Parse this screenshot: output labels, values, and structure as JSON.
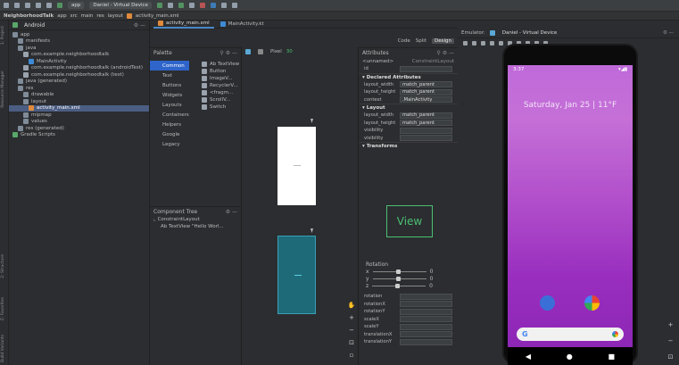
{
  "toolbar": {
    "run_config": "app",
    "device": "Daniel - Virtual Device"
  },
  "breadcrumb": [
    "NeighborhoodTalk",
    "app",
    "src",
    "main",
    "res",
    "layout",
    "activity_main.xml"
  ],
  "left_strip": [
    "1: Project",
    "Resource Manager",
    "2: Structure",
    "Z: Favorites",
    "Build Variants"
  ],
  "project": {
    "view": "Android",
    "tree": [
      {
        "label": "app",
        "indent": 0,
        "icon": "folder-icon"
      },
      {
        "label": "manifests",
        "indent": 1,
        "icon": "folder-icon"
      },
      {
        "label": "java",
        "indent": 1,
        "icon": "folder-icon"
      },
      {
        "label": "com.example.neighborhoodtalk",
        "indent": 2,
        "icon": "package-icon"
      },
      {
        "label": "MainActivity",
        "indent": 3,
        "icon": "class-icon"
      },
      {
        "label": "com.example.neighborhoodtalk (androidTest)",
        "indent": 2,
        "icon": "package-icon"
      },
      {
        "label": "com.example.neighborhoodtalk (test)",
        "indent": 2,
        "icon": "package-icon"
      },
      {
        "label": "java (generated)",
        "indent": 1,
        "icon": "folder-icon"
      },
      {
        "label": "res",
        "indent": 1,
        "icon": "folder-icon"
      },
      {
        "label": "drawable",
        "indent": 2,
        "icon": "folder-icon"
      },
      {
        "label": "layout",
        "indent": 2,
        "icon": "folder-icon"
      },
      {
        "label": "activity_main.xml",
        "indent": 3,
        "icon": "layout-file-icon",
        "selected": true
      },
      {
        "label": "mipmap",
        "indent": 2,
        "icon": "folder-icon"
      },
      {
        "label": "values",
        "indent": 2,
        "icon": "folder-icon"
      },
      {
        "label": "res (generated)",
        "indent": 1,
        "icon": "folder-icon"
      },
      {
        "label": "Gradle Scripts",
        "indent": 0,
        "icon": "gradle-icon"
      }
    ]
  },
  "editor": {
    "tabs": [
      {
        "label": "activity_main.xml",
        "active": true
      },
      {
        "label": "MainActivity.kt",
        "active": false
      }
    ],
    "modes": [
      "Code",
      "Split",
      "Design"
    ],
    "active_mode": "Design"
  },
  "palette": {
    "title": "Palette",
    "categories": [
      "Common",
      "Text",
      "Buttons",
      "Widgets",
      "Layouts",
      "Containers",
      "Helpers",
      "Google",
      "Legacy"
    ],
    "selected_category": "Common",
    "items": [
      "Ab TextView",
      "Button",
      "ImageV...",
      "RecyclerV...",
      "<fragm...",
      "ScrollV...",
      "Switch"
    ]
  },
  "component_tree": {
    "title": "Component Tree",
    "items": [
      "ConstraintLayout",
      "Ab TextView \"Hello Worl..."
    ]
  },
  "surface": {
    "device": "Pixel",
    "api": "30"
  },
  "attributes": {
    "title": "Attributes",
    "component": "<unnamed>",
    "component_type": "ConstraintLayout",
    "id_label": "id",
    "declared_title": "Declared Attributes",
    "declared": [
      {
        "key": "layout_width",
        "value": "match_parent"
      },
      {
        "key": "layout_height",
        "value": "match_parent"
      },
      {
        "key": "context",
        "value": ".MainActivity"
      }
    ],
    "layout_title": "Layout",
    "layout": [
      {
        "key": "layout_width",
        "value": "match_parent"
      },
      {
        "key": "layout_height",
        "value": "match_parent"
      },
      {
        "key": "visibility",
        "value": ""
      },
      {
        "key": "visibility",
        "value": ""
      }
    ],
    "transforms_title": "Transforms",
    "view_label": "View",
    "rotation_label": "Rotation",
    "rotation_axes": [
      {
        "axis": "x",
        "value": "0"
      },
      {
        "axis": "y",
        "value": "0"
      },
      {
        "axis": "z",
        "value": "0"
      }
    ],
    "extra": [
      "rotation",
      "rotationX",
      "rotationY",
      "scaleX",
      "scaleY",
      "translationX",
      "translationY"
    ]
  },
  "emulator": {
    "label": "Emulator:",
    "device": "Daniel - Virtual Device",
    "status_time": "3:37",
    "date": "Saturday, Jan 25 | 11°F",
    "search_letter": "G"
  },
  "colors": {
    "accent": "#2f65ca",
    "blueprint": "#1e6a79",
    "view_outline": "#4cbf73",
    "wallpaper": "#b14fcb"
  }
}
